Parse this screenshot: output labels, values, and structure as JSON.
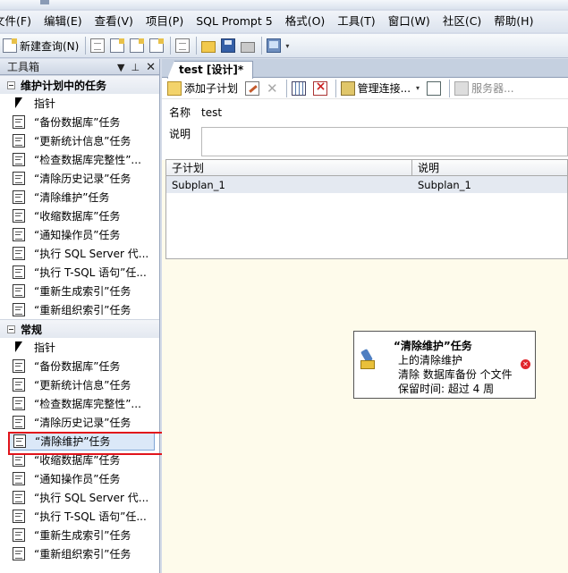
{
  "menubar": {
    "items": [
      "文件(F)",
      "编辑(E)",
      "查看(V)",
      "项目(P)",
      "SQL Prompt 5",
      "格式(O)",
      "工具(T)",
      "窗口(W)",
      "社区(C)",
      "帮助(H)"
    ]
  },
  "toolbar": {
    "new_query_label": "新建查询(N)"
  },
  "toolbox": {
    "title": "工具箱",
    "groups": [
      {
        "label": "维护计划中的任务",
        "items": [
          "指针",
          "“备份数据库”任务",
          "“更新统计信息”任务",
          "“检查数据库完整性”...",
          "“清除历史记录”任务",
          "“清除维护”任务",
          "“收缩数据库”任务",
          "“通知操作员”任务",
          "“执行 SQL Server 代...",
          "“执行 T-SQL 语句”任...",
          "“重新生成索引”任务",
          "“重新组织索引”任务"
        ]
      },
      {
        "label": "常规",
        "items": [
          "指针",
          "“备份数据库”任务",
          "“更新统计信息”任务",
          "“检查数据库完整性”...",
          "“清除历史记录”任务",
          "“清除维护”任务",
          "“收缩数据库”任务",
          "“通知操作员”任务",
          "“执行 SQL Server 代...",
          "“执行 T-SQL 语句”任...",
          "“重新生成索引”任务",
          "“重新组织索引”任务"
        ]
      }
    ]
  },
  "designer": {
    "tab_label": "test [设计]*",
    "toolbar": {
      "add_subplan": "添加子计划",
      "manage_connections": "管理连接...",
      "servers": "服务器..."
    },
    "name_label": "名称",
    "name_value": "test",
    "desc_label": "说明",
    "desc_value": "",
    "subplans": {
      "headers": [
        "子计划",
        "说明"
      ],
      "rows": [
        [
          "Subplan_1",
          "Subplan_1"
        ]
      ]
    },
    "task": {
      "title": "“清除维护”任务",
      "line1": "上的清除维护",
      "line2": "清除 数据库备份 个文件",
      "line3": "保留时间: 超过 4 周"
    }
  }
}
